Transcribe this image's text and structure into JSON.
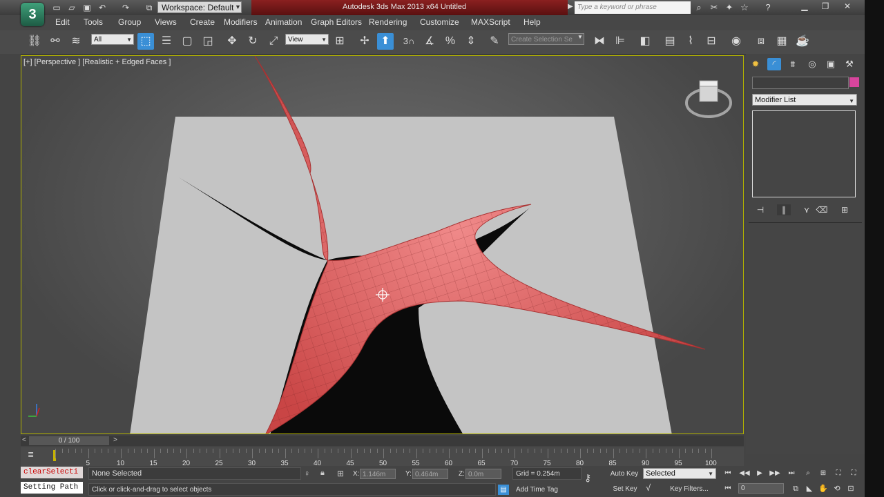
{
  "titlebar": {
    "app_icon": "3ds-max-logo",
    "workspace": "Workspace: Default",
    "title": "Autodesk 3ds Max  2013 x64      Untitled",
    "search_placeholder": "Type a keyword or phrase"
  },
  "menus": [
    "Edit",
    "Tools",
    "Group",
    "Views",
    "Create",
    "Modifiers",
    "Animation",
    "Graph Editors",
    "Rendering",
    "Customize",
    "MAXScript",
    "Help"
  ],
  "toolbar": {
    "selection_filter": "All",
    "reference_coord": "View",
    "snap_value": "3",
    "named_selection_placeholder": "Create Selection Se"
  },
  "viewport": {
    "label": "[+] [Perspective ] [Realistic + Edged Faces ]",
    "accent_color": "#b2b200",
    "surface_color": "#e06060"
  },
  "command_panel": {
    "modifier_list": "Modifier List",
    "color_swatch": "#d8459d"
  },
  "time_slider": {
    "frame_display": "0 / 100",
    "ticks": [
      "5",
      "10",
      "15",
      "20",
      "25",
      "30",
      "35",
      "40",
      "45",
      "50",
      "55",
      "60",
      "65",
      "70",
      "75",
      "80",
      "85",
      "90",
      "95",
      "100"
    ]
  },
  "status": {
    "maxscript_listener": "clearSelecti",
    "maxscript_output": "Setting Path",
    "selection_status": "None Selected",
    "prompt": "Click or click-and-drag to select objects",
    "x_label": "X:",
    "x_value": "1.146m",
    "y_label": "Y:",
    "y_value": "0.464m",
    "z_label": "Z:",
    "z_value": "0.0m",
    "grid": "Grid = 0.254m",
    "add_time_tag": "Add Time Tag",
    "auto_key": "Auto Key",
    "set_key": "Set Key",
    "key_mode": "Selected",
    "key_filters": "Key Filters...",
    "current_frame": "0"
  }
}
